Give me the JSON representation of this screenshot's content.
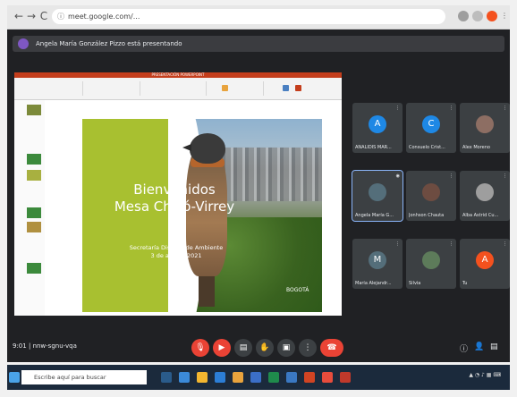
{
  "browser": {
    "back": "←",
    "forward": "→",
    "reload": "C",
    "url": "meet.google.com/...",
    "lock": "ⓘ"
  },
  "banner": {
    "text": "Angela María González Pizzo está presentando"
  },
  "powerpoint": {
    "title_bar": "PRESENTACIÓN POWERPOINT"
  },
  "slide": {
    "welcome_line1": "Bienvenidos",
    "welcome_line2": "Mesa Chicó-Virrey",
    "sub_line1": "Secretaría Distrital de Ambiente",
    "sub_line2": "3 de agosto 2021",
    "logo_text": "BOGOTÁ"
  },
  "participants": [
    {
      "initial": "A",
      "name": "ANALIDIS MAR...",
      "color": "#1e88e5"
    },
    {
      "initial": "C",
      "name": "Consuelo Crist...",
      "color": "#1e88e5"
    },
    {
      "initial": "",
      "name": "Alex Moreno",
      "color": "#8d6e63"
    },
    {
      "initial": "",
      "name": "Angela María G...",
      "color": "#546e7a"
    },
    {
      "initial": "",
      "name": "Jonhson Chauta",
      "color": "#6d4c41"
    },
    {
      "initial": "",
      "name": "Alba Astrid Cu...",
      "color": "#9e9e9e"
    },
    {
      "initial": "M",
      "name": "María Alejandr...",
      "color": "#546e7a"
    },
    {
      "initial": "",
      "name": "Silvia",
      "color": "#5d7b5a"
    },
    {
      "initial": "A",
      "name": "Tu",
      "color": "#f4511e"
    }
  ],
  "meetbar": {
    "time": "9:01",
    "meeting_code": "nnw-sgnu-vqa"
  },
  "taskbar": {
    "search_placeholder": "Escribe aquí para buscar"
  },
  "colors": {
    "meet_bg": "#202124",
    "end_call": "#ea4335",
    "mic_off": "#ea4335",
    "slide_green": "#a8c030"
  }
}
